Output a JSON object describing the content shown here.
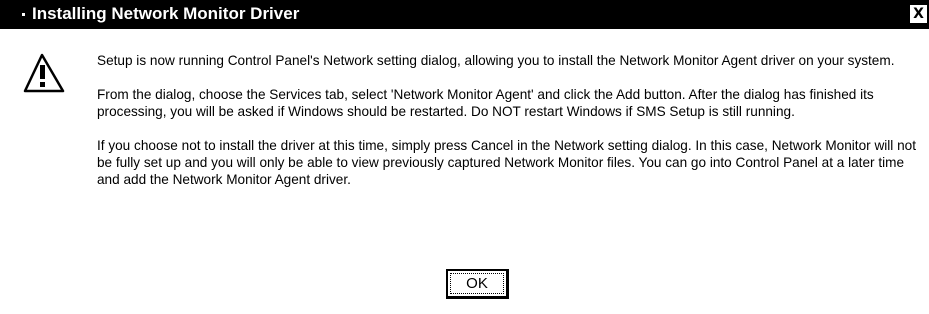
{
  "window": {
    "title": "Installing Network Monitor Driver",
    "close_label": "X"
  },
  "icon": {
    "name": "warning-icon"
  },
  "message": {
    "paragraphs": [
      "Setup is now running Control Panel's Network setting dialog, allowing you to install the Network Monitor Agent driver on your system.",
      "From the dialog, choose the Services tab, select 'Network Monitor Agent' and click the Add button.  After the dialog has finished its processing, you will be asked if Windows should be restarted.  Do NOT restart Windows if SMS Setup is still running.",
      "If you choose not to install the driver at this time, simply press Cancel in the Network setting dialog.  In this case, Network Monitor will not be fully set up and you will only be able to view previously captured Network Monitor files.  You can go into Control Panel at a later time and add the Network Monitor Agent driver."
    ]
  },
  "buttons": {
    "ok_label": "OK"
  }
}
